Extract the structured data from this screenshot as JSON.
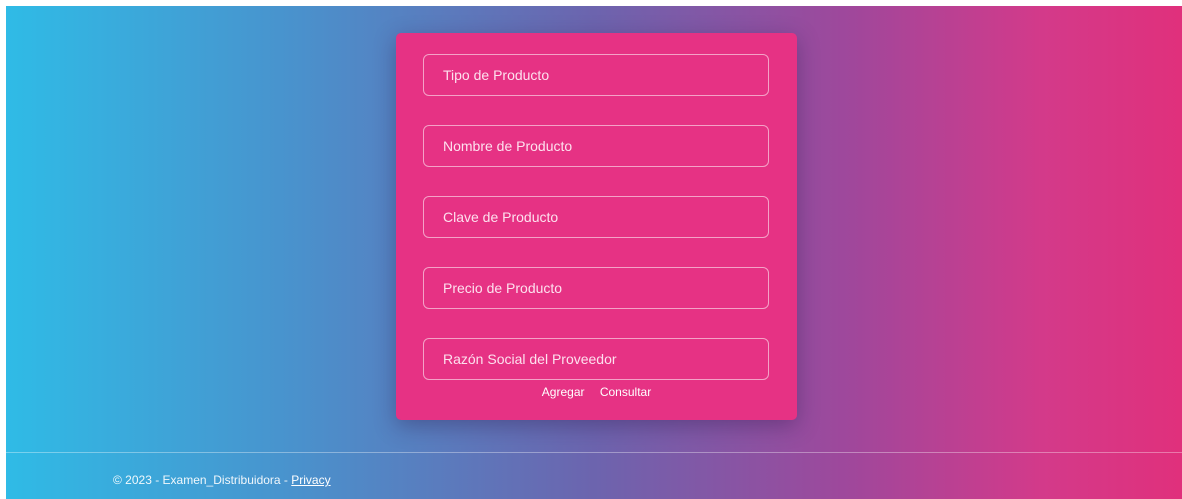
{
  "form": {
    "fields": [
      {
        "placeholder": "Tipo de Producto"
      },
      {
        "placeholder": "Nombre de Producto"
      },
      {
        "placeholder": "Clave de Producto"
      },
      {
        "placeholder": "Precio de Producto"
      },
      {
        "placeholder": "Razón Social del Proveedor"
      }
    ],
    "actions": {
      "add_label": "Agregar",
      "query_label": "Consultar"
    }
  },
  "footer": {
    "copyright": "© 2023 - Examen_Distribuidora - ",
    "privacy_label": "Privacy"
  },
  "colors": {
    "card": "#e63284",
    "gradient_left": "#2fbbe6",
    "gradient_mid": "#6c64ae",
    "gradient_right": "#e0307c"
  }
}
